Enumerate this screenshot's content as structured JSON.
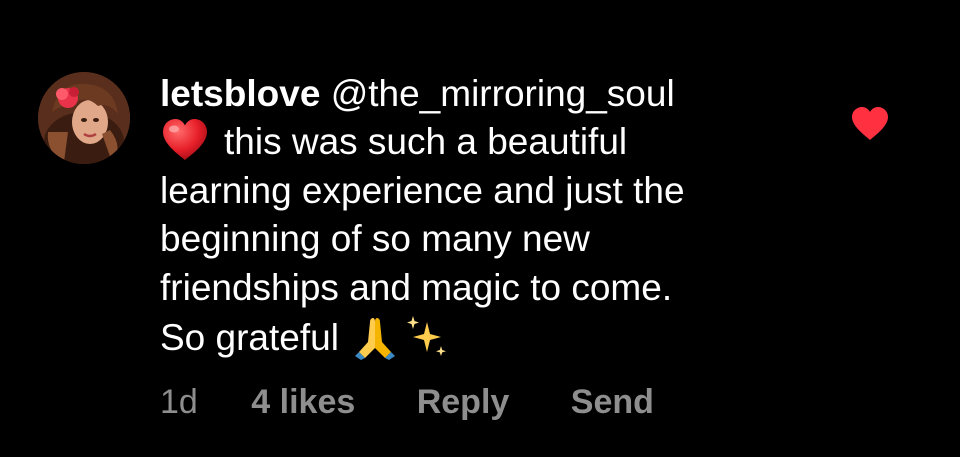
{
  "comment": {
    "username": "letsblove",
    "mention": "@the_mirroring_soul",
    "body_lines": [
      "this was such a beautiful",
      "learning experience and just the",
      "beginning of so many new",
      "friendships and magic to come.",
      "So grateful"
    ],
    "body_emojis": [
      "heart-emoji",
      "folded-hands-emoji",
      "sparkles-emoji"
    ],
    "time": "1d",
    "likes": "4 likes",
    "reply_label": "Reply",
    "send_label": "Send",
    "liked": true
  },
  "colors": {
    "background": "#000000",
    "text": "#ffffff",
    "secondary_text": "#8e8e8e",
    "like_red": "#ff3040"
  }
}
